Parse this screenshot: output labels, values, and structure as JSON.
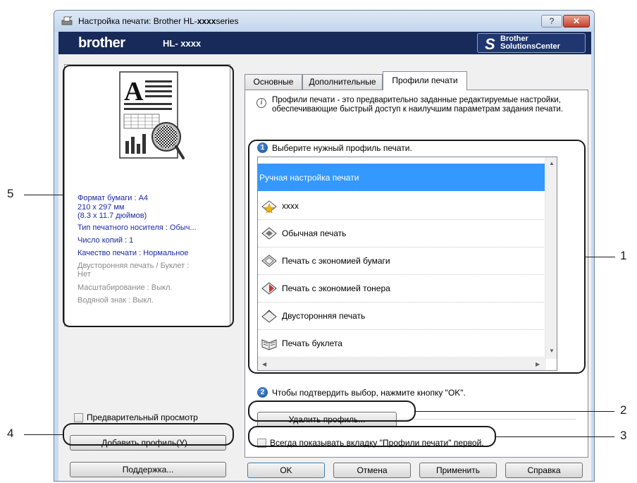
{
  "window": {
    "title_prefix": "Настройка печати: Brother HL-",
    "title_bold": "xxxx",
    "title_suffix": "series",
    "help_label": "?",
    "close_label": "✕"
  },
  "brand": {
    "logo": "brother",
    "model": "HL- xxxx",
    "solutions_line1": "Brother",
    "solutions_line2": "SolutionsCenter"
  },
  "preview": {
    "info": [
      {
        "text": "Формат бумаги : A4",
        "style": "blue"
      },
      {
        "text": "210 x 297 мм",
        "style": "blue"
      },
      {
        "text": "(8.3 x 11.7 дюймов)",
        "style": "blue"
      },
      {
        "text": "Тип печатного носителя : Обыч...",
        "style": "blue"
      },
      {
        "text": "Число копий : 1",
        "style": "blue"
      },
      {
        "text": "Качество печати : Нормальное",
        "style": "blue"
      },
      {
        "text": "Двусторонняя печать / Буклет :",
        "style": "gray"
      },
      {
        "text": "Нет",
        "style": "gray"
      },
      {
        "text": "Масштабирование : Выкл.",
        "style": "gray"
      },
      {
        "text": "Водяной знак : Выкл.",
        "style": "gray"
      }
    ],
    "preview_checkbox_label": "Предварительный просмотр",
    "add_profile_button": "Добавить профиль(У)...",
    "support_button": "Поддержка..."
  },
  "tabs": [
    "Основные",
    "Дополнительные",
    "Профили печати"
  ],
  "profiles_tab": {
    "info_text": "Профили печати - это предварительно заданные редактируемые настройки, обеспечивающие быстрый доступ к наилучшим параметрам задания печати.",
    "step1_num": "1",
    "step1_text": "Выберите нужный профиль печати.",
    "items": [
      "Ручная настройка печати",
      "xxxx",
      "Обычная печать",
      "Печать с экономией бумаги",
      "Печать с экономией тонера",
      "Двусторонняя печать",
      "Печать буклета"
    ],
    "step2_num": "2",
    "step2_text": "Чтобы подтвердить выбор, нажмите кнопку \"OK\".",
    "delete_button": "Удалить профиль...",
    "always_show_checkbox": "Всегда показывать вкладку \"Профили печати\" первой."
  },
  "footer": {
    "ok": "OK",
    "cancel": "Отмена",
    "apply": "Применить",
    "help": "Справка"
  },
  "callouts": [
    "1",
    "2",
    "3",
    "4",
    "5"
  ]
}
